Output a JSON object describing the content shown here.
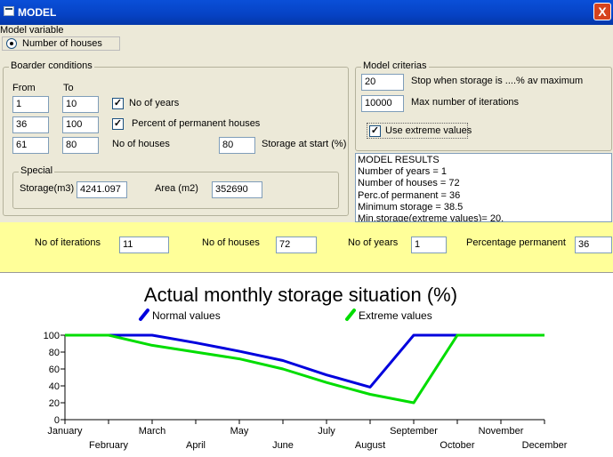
{
  "window": {
    "title": "MODEL",
    "close_label": "X"
  },
  "model_variable": {
    "label": "Model variable",
    "option_label": "Number of houses"
  },
  "border_conditions": {
    "label": "Boarder conditions",
    "from_label": "From",
    "to_label": "To",
    "rows": [
      {
        "from": "1",
        "to": "10",
        "desc": "No of years",
        "checked": true
      },
      {
        "from": "36",
        "to": "100",
        "desc": "Percent of permanent houses",
        "checked": true
      },
      {
        "from": "61",
        "to": "80",
        "desc": "No of houses",
        "checked": false
      }
    ],
    "storage_start_value": "80",
    "storage_start_label": "Storage at start (%)"
  },
  "special": {
    "label": "Special",
    "storage_label": "Storage(m3)",
    "storage_value": "4241.097",
    "area_label": "Area (m2)",
    "area_value": "352690"
  },
  "criterias": {
    "label": "Model criterias",
    "stop_value": "20",
    "stop_label": "Stop when storage is ....% av maximum",
    "max_iter_value": "10000",
    "max_iter_label": "Max number of iterations",
    "extreme_label": "Use extreme values",
    "extreme_checked": true
  },
  "results": {
    "lines": [
      "MODEL RESULTS",
      "Number of years  =  1",
      "Number of houses =  72",
      "Perc.of permanent = 36",
      "Minimum storage  =  38.5",
      "Min.storage(extreme values)=   20."
    ]
  },
  "summary": {
    "iterations_label": "No of iterations",
    "iterations_value": "11",
    "houses_label": "No of houses",
    "houses_value": "72",
    "years_label": "No of years",
    "years_value": "1",
    "percent_label": "Percentage permanent",
    "percent_value": "36"
  },
  "chart_data": {
    "type": "line",
    "title": "Actual monthly storage situation (%)",
    "categories": [
      "January",
      "February",
      "March",
      "April",
      "May",
      "June",
      "July",
      "August",
      "September",
      "October",
      "November",
      "December"
    ],
    "ylim": [
      0,
      100
    ],
    "yticks": [
      0,
      20,
      40,
      60,
      80,
      100
    ],
    "series": [
      {
        "name": "Normal values",
        "color": "#0000dd",
        "values": [
          100,
          100,
          100,
          91,
          81,
          70,
          53,
          38.5,
          100,
          100,
          100,
          100
        ]
      },
      {
        "name": "Extreme values",
        "color": "#00dd00",
        "values": [
          100,
          100,
          88,
          80,
          72,
          60,
          44,
          30,
          20,
          100,
          100,
          100
        ]
      }
    ]
  }
}
